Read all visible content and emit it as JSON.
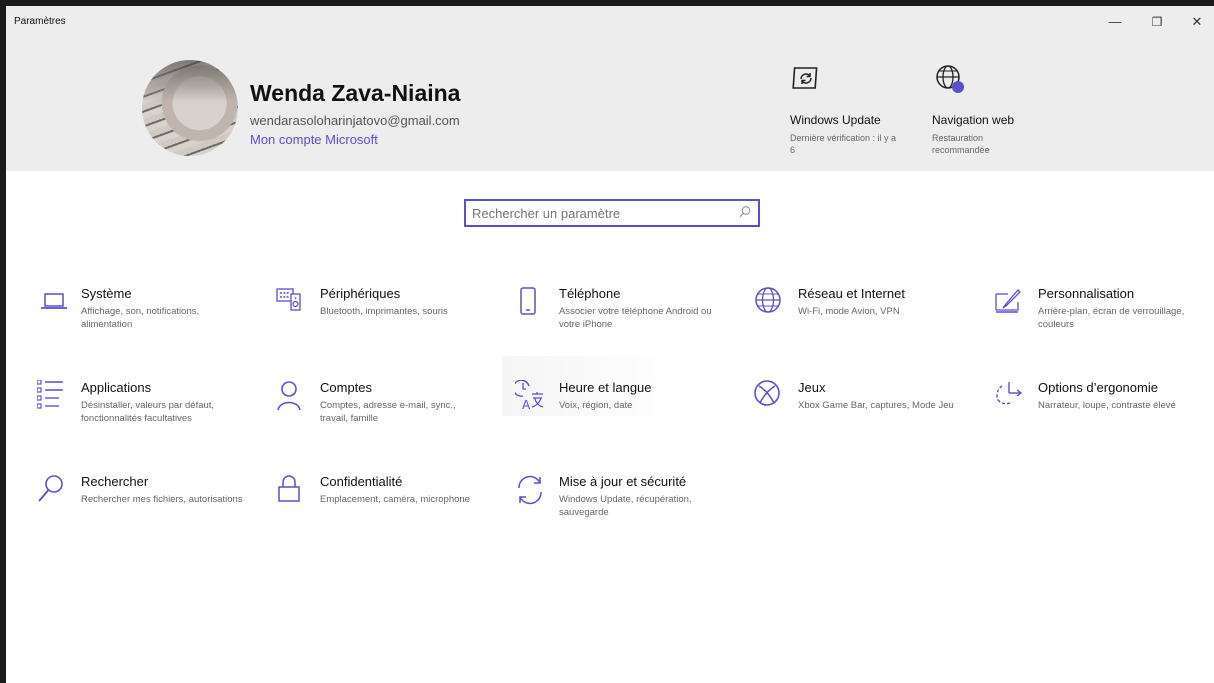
{
  "window": {
    "title": "Paramètres",
    "minimize": "—",
    "maximize": "❐",
    "close": "✕"
  },
  "user": {
    "name": "Wenda Zava-Niaina",
    "email": "wendarasoloharinjatovo@gmail.com",
    "account_link": "Mon compte Microsoft"
  },
  "quick_links": [
    {
      "icon": "windows-update-icon",
      "title": "Windows Update",
      "subtitle": "Dernière vérification : il y a 6"
    },
    {
      "icon": "web-globe-icon",
      "title": "Navigation web",
      "subtitle": "Restauration recommandée"
    }
  ],
  "search": {
    "placeholder": "Rechercher un paramètre",
    "value": ""
  },
  "tiles": [
    {
      "icon": "laptop-icon",
      "title": "Système",
      "desc": "Affichage, son, notifications, alimentation"
    },
    {
      "icon": "keyboard-icon",
      "title": "Périphériques",
      "desc": "Bluetooth, imprimantes, souris"
    },
    {
      "icon": "phone-icon",
      "title": "Téléphone",
      "desc": "Associer votre téléphone Android ou votre iPhone"
    },
    {
      "icon": "globe-icon",
      "title": "Réseau et Internet",
      "desc": "Wi-Fi, mode Avion, VPN"
    },
    {
      "icon": "paintbrush-icon",
      "title": "Personnalisation",
      "desc": "Arrière-plan, écran de verrouillage, couleurs"
    },
    {
      "icon": "apps-list-icon",
      "title": "Applications",
      "desc": "Désinstaller, valeurs par défaut, fonctionnalités facultatives"
    },
    {
      "icon": "person-icon",
      "title": "Comptes",
      "desc": "Comptes, adresse e-mail, sync., travail, famille"
    },
    {
      "icon": "time-language-icon",
      "title": "Heure et langue",
      "desc": "Voix, région, date"
    },
    {
      "icon": "xbox-icon",
      "title": "Jeux",
      "desc": "Xbox Game Bar, captures, Mode Jeu"
    },
    {
      "icon": "accessibility-icon",
      "title": "Options d’ergonomie",
      "desc": "Narrateur, loupe, contraste élevé"
    },
    {
      "icon": "search-icon",
      "title": "Rechercher",
      "desc": "Rechercher mes fichiers, autorisations"
    },
    {
      "icon": "lock-icon",
      "title": "Confidentialité",
      "desc": "Emplacement, caméra, microphone"
    },
    {
      "icon": "sync-icon",
      "title": "Mise à jour et sécurité",
      "desc": "Windows Update, récupération, sauvegarde"
    }
  ],
  "colors": {
    "accent": "#5a4fcf",
    "header_bg": "#ededed",
    "window_bg": "#ffffff",
    "text_secondary": "#666666"
  }
}
